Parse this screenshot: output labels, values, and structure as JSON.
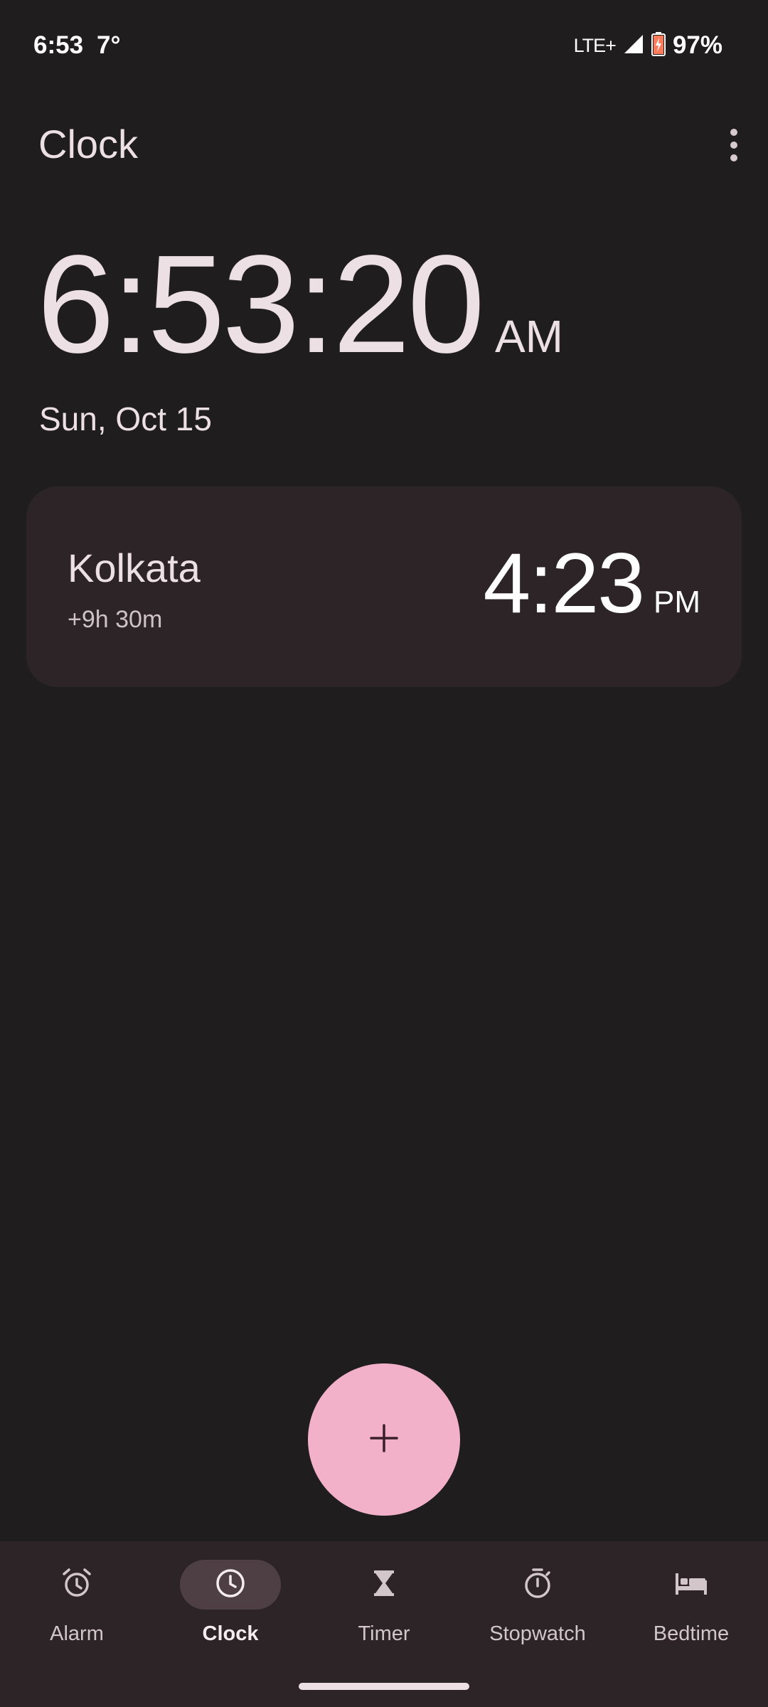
{
  "status_bar": {
    "time": "6:53",
    "temperature": "7°",
    "network": "LTE+",
    "battery": "97%"
  },
  "app_bar": {
    "title": "Clock",
    "overflow_icon": "more-vert-icon"
  },
  "main_clock": {
    "time": "6:53:20",
    "ampm": "AM",
    "date": "Sun, Oct 15"
  },
  "world_clocks": [
    {
      "city": "Kolkata",
      "offset": "+9h 30m",
      "time": "4:23",
      "ampm": "PM"
    }
  ],
  "fab": {
    "icon": "plus-icon"
  },
  "bottom_nav": {
    "items": [
      {
        "label": "Alarm",
        "icon": "alarm-icon",
        "active": false
      },
      {
        "label": "Clock",
        "icon": "clock-icon",
        "active": true
      },
      {
        "label": "Timer",
        "icon": "hourglass-icon",
        "active": false
      },
      {
        "label": "Stopwatch",
        "icon": "stopwatch-icon",
        "active": false
      },
      {
        "label": "Bedtime",
        "icon": "bed-icon",
        "active": false
      }
    ]
  },
  "colors": {
    "background": "#201d1e",
    "card": "#2c2427",
    "fab": "#f2b1c8",
    "nav_active_pill": "#4e3f45",
    "text_primary": "#ece0e4"
  }
}
